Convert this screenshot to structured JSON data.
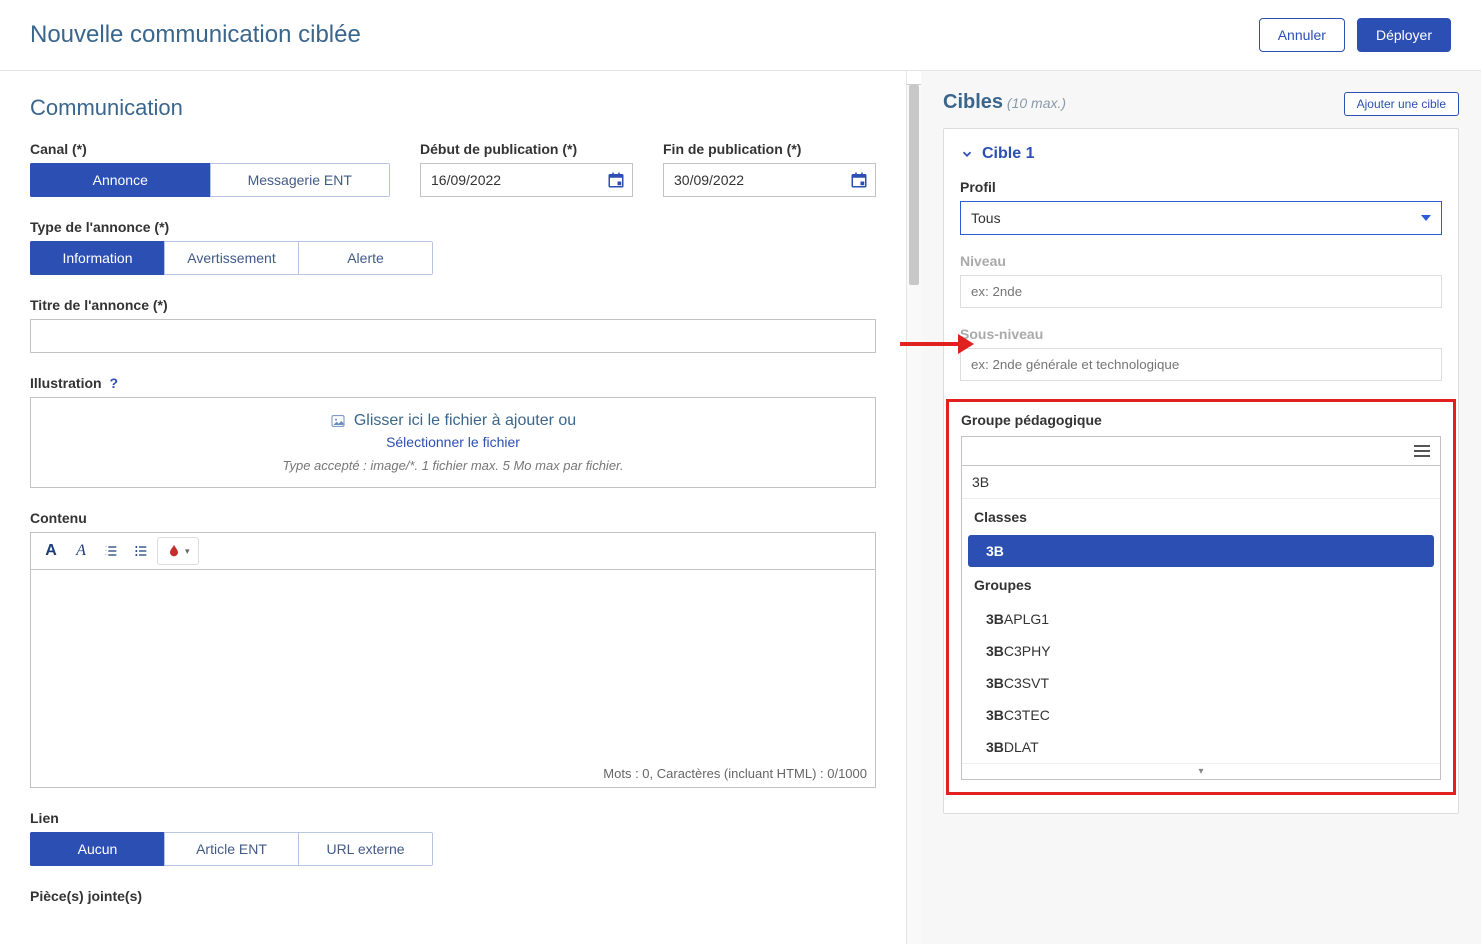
{
  "header": {
    "title": "Nouvelle communication ciblée",
    "cancel": "Annuler",
    "deploy": "Déployer"
  },
  "main": {
    "section_title": "Communication",
    "canal": {
      "label": "Canal (*)",
      "options": [
        "Annonce",
        "Messagerie ENT"
      ],
      "selected": "Annonce"
    },
    "start_date": {
      "label": "Début de publication (*)",
      "value": "16/09/2022"
    },
    "end_date": {
      "label": "Fin de publication (*)",
      "value": "30/09/2022"
    },
    "announce_type": {
      "label": "Type de l'annonce (*)",
      "options": [
        "Information",
        "Avertissement",
        "Alerte"
      ],
      "selected": "Information"
    },
    "title_field": {
      "label": "Titre de l'annonce (*)",
      "value": ""
    },
    "illustration": {
      "label": "Illustration",
      "drop_text": "Glisser ici le fichier à ajouter ou",
      "select_link": "Sélectionner le fichier",
      "hint": "Type accepté : image/*. 1 fichier max. 5 Mo max par fichier."
    },
    "content": {
      "label": "Contenu",
      "footer": "Mots : 0, Caractères (incluant HTML) : 0/1000"
    },
    "link": {
      "label": "Lien",
      "options": [
        "Aucun",
        "Article ENT",
        "URL externe"
      ],
      "selected": "Aucun"
    },
    "attachments": {
      "label": "Pièce(s) jointe(s)"
    }
  },
  "right": {
    "title": "Cibles",
    "max_hint": "(10 max.)",
    "add_button": "Ajouter une cible",
    "target_header": "Cible 1",
    "profile": {
      "label": "Profil",
      "value": "Tous"
    },
    "niveau": {
      "label": "Niveau",
      "placeholder": "ex: 2nde"
    },
    "sous_niveau": {
      "label": "Sous-niveau",
      "placeholder": "ex: 2nde générale et technologique"
    },
    "groupe": {
      "label": "Groupe pédagogique",
      "search": "3B",
      "section_classes": "Classes",
      "classes": [
        {
          "match": "3B",
          "rest": ""
        }
      ],
      "section_groupes": "Groupes",
      "groupes": [
        {
          "match": "3B",
          "rest": "APLG1"
        },
        {
          "match": "3B",
          "rest": "C3PHY"
        },
        {
          "match": "3B",
          "rest": "C3SVT"
        },
        {
          "match": "3B",
          "rest": "C3TEC"
        },
        {
          "match": "3B",
          "rest": "DLAT"
        }
      ]
    }
  }
}
